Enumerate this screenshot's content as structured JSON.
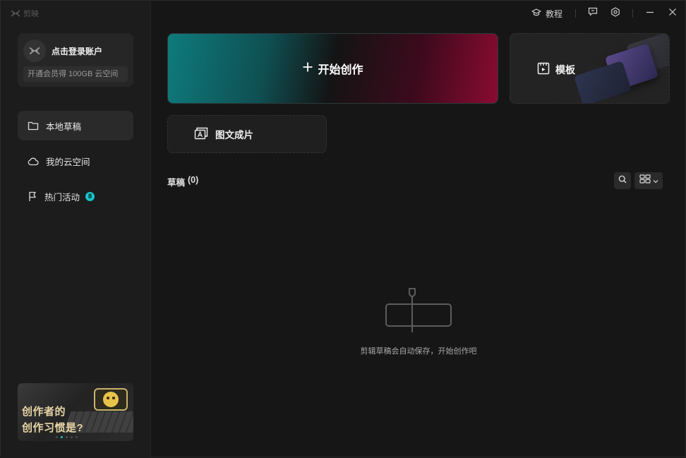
{
  "app": {
    "name": "剪映"
  },
  "sidebar": {
    "login": {
      "label": "点击登录账户",
      "vip_promo": "开通会员得 100GB 云空间"
    },
    "items": [
      {
        "label": "本地草稿",
        "icon": "folder-icon",
        "active": true
      },
      {
        "label": "我的云空间",
        "icon": "cloud-icon",
        "active": false
      },
      {
        "label": "热门活动",
        "icon": "flag-icon",
        "active": false,
        "badge": "8"
      }
    ],
    "promo": {
      "line1": "创作者的",
      "line2": "创作习惯是?"
    }
  },
  "titlebar": {
    "tutorial_label": "教程"
  },
  "main": {
    "create_label": "开始创作",
    "template_label": "模板",
    "imgtext_label": "图文成片",
    "drafts_title": "草稿",
    "drafts_count": "(0)",
    "empty_message": "剪辑草稿会自动保存，开始创作吧"
  },
  "colors": {
    "accent": "#17c3c7",
    "create_gradient_left": "#0e7b7c",
    "create_gradient_right": "#8a0b32",
    "background": "#161616",
    "sidebar": "#1c1c1c"
  }
}
